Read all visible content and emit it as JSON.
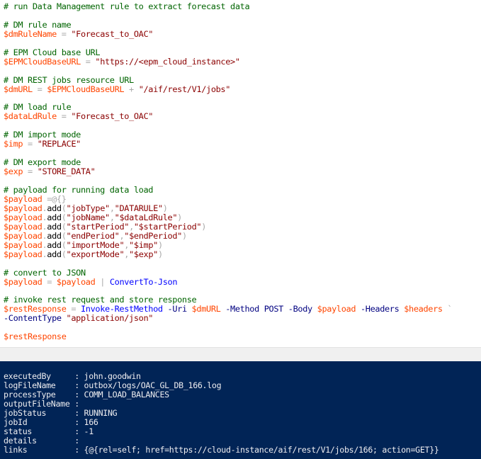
{
  "editor": {
    "lines": [
      [
        {
          "t": "# run Data Management rule to extract forecast data",
          "c": "cm"
        }
      ],
      [],
      [
        {
          "t": "# DM rule name",
          "c": "cm"
        }
      ],
      [
        {
          "t": "$dmRuleName",
          "c": "vr"
        },
        {
          "t": " = ",
          "c": "op"
        },
        {
          "t": "\"Forecast_to_OAC\"",
          "c": "st"
        }
      ],
      [],
      [
        {
          "t": "# EPM Cloud base URL",
          "c": "cm"
        }
      ],
      [
        {
          "t": "$EPMCloudBaseURL",
          "c": "vr"
        },
        {
          "t": " = ",
          "c": "op"
        },
        {
          "t": "\"https://<epm_cloud_instance>\"",
          "c": "st"
        }
      ],
      [],
      [
        {
          "t": "# DM REST jobs resource URL",
          "c": "cm"
        }
      ],
      [
        {
          "t": "$dmURL",
          "c": "vr"
        },
        {
          "t": " = ",
          "c": "op"
        },
        {
          "t": "$EPMCloudBaseURL",
          "c": "vr"
        },
        {
          "t": " + ",
          "c": "op"
        },
        {
          "t": "\"/aif/rest/V1/jobs\"",
          "c": "st"
        }
      ],
      [],
      [
        {
          "t": "# DM load rule",
          "c": "cm"
        }
      ],
      [
        {
          "t": "$dataLdRule",
          "c": "vr"
        },
        {
          "t": " = ",
          "c": "op"
        },
        {
          "t": "\"Forecast_to_OAC\"",
          "c": "st"
        }
      ],
      [],
      [
        {
          "t": "# DM import mode",
          "c": "cm"
        }
      ],
      [
        {
          "t": "$imp",
          "c": "vr"
        },
        {
          "t": " = ",
          "c": "op"
        },
        {
          "t": "\"REPLACE\"",
          "c": "st"
        }
      ],
      [],
      [
        {
          "t": "# DM export mode",
          "c": "cm"
        }
      ],
      [
        {
          "t": "$exp",
          "c": "vr"
        },
        {
          "t": " = ",
          "c": "op"
        },
        {
          "t": "\"STORE_DATA\"",
          "c": "st"
        }
      ],
      [],
      [
        {
          "t": "# payload for running data load",
          "c": "cm"
        }
      ],
      [
        {
          "t": "$payload",
          "c": "vr"
        },
        {
          "t": " =@{}",
          "c": "op"
        }
      ],
      [
        {
          "t": "$payload",
          "c": "vr"
        },
        {
          "t": ".",
          "c": "op"
        },
        {
          "t": "add",
          "c": "mb"
        },
        {
          "t": "(",
          "c": "op"
        },
        {
          "t": "\"jobType\"",
          "c": "st"
        },
        {
          "t": ",",
          "c": "op"
        },
        {
          "t": "\"DATARULE\"",
          "c": "st"
        },
        {
          "t": ")",
          "c": "op"
        }
      ],
      [
        {
          "t": "$payload",
          "c": "vr"
        },
        {
          "t": ".",
          "c": "op"
        },
        {
          "t": "add",
          "c": "mb"
        },
        {
          "t": "(",
          "c": "op"
        },
        {
          "t": "\"jobName\"",
          "c": "st"
        },
        {
          "t": ",",
          "c": "op"
        },
        {
          "t": "\"$dataLdRule\"",
          "c": "st"
        },
        {
          "t": ")",
          "c": "op"
        }
      ],
      [
        {
          "t": "$payload",
          "c": "vr"
        },
        {
          "t": ".",
          "c": "op"
        },
        {
          "t": "add",
          "c": "mb"
        },
        {
          "t": "(",
          "c": "op"
        },
        {
          "t": "\"startPeriod\"",
          "c": "st"
        },
        {
          "t": ",",
          "c": "op"
        },
        {
          "t": "\"$startPeriod\"",
          "c": "st"
        },
        {
          "t": ")",
          "c": "op"
        }
      ],
      [
        {
          "t": "$payload",
          "c": "vr"
        },
        {
          "t": ".",
          "c": "op"
        },
        {
          "t": "add",
          "c": "mb"
        },
        {
          "t": "(",
          "c": "op"
        },
        {
          "t": "\"endPeriod\"",
          "c": "st"
        },
        {
          "t": ",",
          "c": "op"
        },
        {
          "t": "\"$endPeriod\"",
          "c": "st"
        },
        {
          "t": ")",
          "c": "op"
        }
      ],
      [
        {
          "t": "$payload",
          "c": "vr"
        },
        {
          "t": ".",
          "c": "op"
        },
        {
          "t": "add",
          "c": "mb"
        },
        {
          "t": "(",
          "c": "op"
        },
        {
          "t": "\"importMode\"",
          "c": "st"
        },
        {
          "t": ",",
          "c": "op"
        },
        {
          "t": "\"$imp\"",
          "c": "st"
        },
        {
          "t": ")",
          "c": "op"
        }
      ],
      [
        {
          "t": "$payload",
          "c": "vr"
        },
        {
          "t": ".",
          "c": "op"
        },
        {
          "t": "add",
          "c": "mb"
        },
        {
          "t": "(",
          "c": "op"
        },
        {
          "t": "\"exportMode\"",
          "c": "st"
        },
        {
          "t": ",",
          "c": "op"
        },
        {
          "t": "\"$exp\"",
          "c": "st"
        },
        {
          "t": ")",
          "c": "op"
        }
      ],
      [],
      [
        {
          "t": "# convert to JSON",
          "c": "cm"
        }
      ],
      [
        {
          "t": "$payload",
          "c": "vr"
        },
        {
          "t": " = ",
          "c": "op"
        },
        {
          "t": "$payload",
          "c": "vr"
        },
        {
          "t": " | ",
          "c": "op"
        },
        {
          "t": "ConvertTo-Json",
          "c": "cd"
        }
      ],
      [],
      [
        {
          "t": "# invoke rest request and store response",
          "c": "cm"
        }
      ],
      [
        {
          "t": "$restResponse",
          "c": "vr"
        },
        {
          "t": " = ",
          "c": "op"
        },
        {
          "t": "Invoke-RestMethod",
          "c": "cd"
        },
        {
          "t": " ",
          "c": "tx"
        },
        {
          "t": "-Uri",
          "c": "pm"
        },
        {
          "t": " ",
          "c": "tx"
        },
        {
          "t": "$dmURL",
          "c": "vr"
        },
        {
          "t": " ",
          "c": "tx"
        },
        {
          "t": "-Method",
          "c": "pm"
        },
        {
          "t": " ",
          "c": "tx"
        },
        {
          "t": "POST",
          "c": "pm"
        },
        {
          "t": " ",
          "c": "tx"
        },
        {
          "t": "-Body",
          "c": "pm"
        },
        {
          "t": " ",
          "c": "tx"
        },
        {
          "t": "$payload",
          "c": "vr"
        },
        {
          "t": " ",
          "c": "tx"
        },
        {
          "t": "-Headers",
          "c": "pm"
        },
        {
          "t": " ",
          "c": "tx"
        },
        {
          "t": "$headers",
          "c": "vr"
        },
        {
          "t": " `",
          "c": "op"
        }
      ],
      [
        {
          "t": "-ContentType",
          "c": "pm"
        },
        {
          "t": " ",
          "c": "tx"
        },
        {
          "t": "\"application/json\"",
          "c": "st"
        }
      ],
      [],
      [
        {
          "t": "$restResponse",
          "c": "vr"
        }
      ]
    ]
  },
  "console": {
    "lines": [
      "",
      "executedBy     : john.goodwin",
      "logFileName    : outbox/logs/OAC_GL_DB_166.log",
      "processType    : COMM_LOAD_BALANCES",
      "outputFileName :",
      "jobStatus      : RUNNING",
      "jobId          : 166",
      "status         : -1",
      "details        :",
      "links          : {@{rel=self; href=https://cloud-instance/aif/rest/V1/jobs/166; action=GET}}"
    ]
  },
  "colors": {
    "comment": "#006400",
    "variable": "#ff4500",
    "string": "#8b0000",
    "operator": "#a9a9a9",
    "command": "#0000ff",
    "parameter": "#000080",
    "console_bg": "#012456",
    "console_fg": "#eeedf0"
  }
}
